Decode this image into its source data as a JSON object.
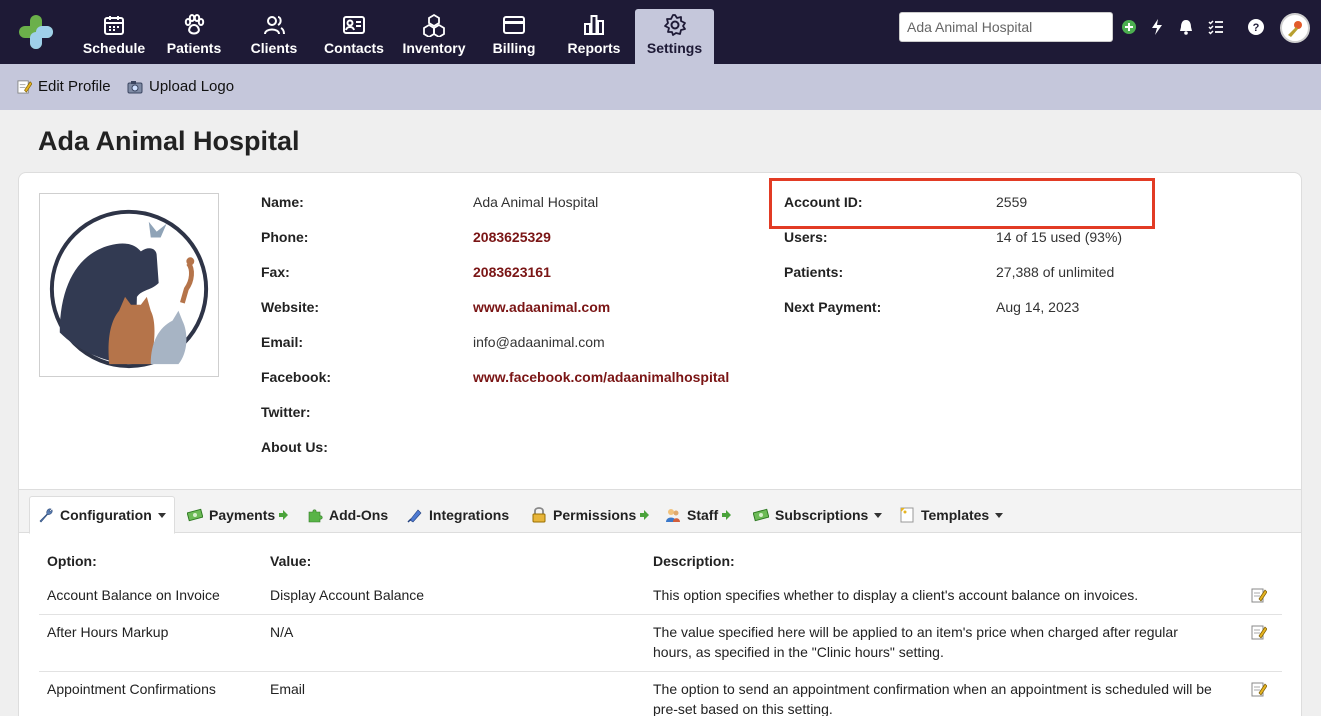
{
  "nav": {
    "items": [
      {
        "label": "Schedule",
        "icon": "calendar-icon"
      },
      {
        "label": "Patients",
        "icon": "paw-icon"
      },
      {
        "label": "Clients",
        "icon": "people-icon"
      },
      {
        "label": "Contacts",
        "icon": "contact-card-icon"
      },
      {
        "label": "Inventory",
        "icon": "boxes-icon"
      },
      {
        "label": "Billing",
        "icon": "credit-card-icon"
      },
      {
        "label": "Reports",
        "icon": "bar-chart-icon"
      },
      {
        "label": "Settings",
        "icon": "gear-icon",
        "active": true
      }
    ],
    "search_value": "Ada Animal Hospital"
  },
  "subbar": {
    "edit_profile": "Edit Profile",
    "upload_logo": "Upload Logo"
  },
  "page_title": "Ada Animal Hospital",
  "profile": {
    "left": [
      {
        "label": "Name:",
        "value": "Ada Animal Hospital",
        "link": false
      },
      {
        "label": "Phone:",
        "value": "2083625329",
        "link": true
      },
      {
        "label": "Fax:",
        "value": "2083623161",
        "link": true
      },
      {
        "label": "Website:",
        "value": "www.adaanimal.com",
        "link": true
      },
      {
        "label": "Email:",
        "value": "info@adaanimal.com",
        "link": false
      },
      {
        "label": "Facebook:",
        "value": "www.facebook.com/adaanimalhospital",
        "link": true
      },
      {
        "label": "Twitter:",
        "value": "",
        "link": false
      },
      {
        "label": "About Us:",
        "value": "",
        "link": false
      }
    ],
    "right": [
      {
        "label": "Account ID:",
        "value": "2559"
      },
      {
        "label": "Users:",
        "value": "14 of 15 used (93%)"
      },
      {
        "label": "Patients:",
        "value": "27,388 of unlimited"
      },
      {
        "label": "Next Payment:",
        "value": "Aug 14, 2023"
      }
    ]
  },
  "tabs": [
    {
      "label": "Configuration",
      "icon": "wrench-icon",
      "suffix": "caret"
    },
    {
      "label": "Payments",
      "icon": "money-icon",
      "suffix": "arrow"
    },
    {
      "label": "Add-Ons",
      "icon": "puzzle-icon",
      "suffix": ""
    },
    {
      "label": "Integrations",
      "icon": "plug-icon",
      "suffix": ""
    },
    {
      "label": "Permissions",
      "icon": "lock-icon",
      "suffix": "arrow"
    },
    {
      "label": "Staff",
      "icon": "staff-icon",
      "suffix": "arrow"
    },
    {
      "label": "Subscriptions",
      "icon": "money-icon",
      "suffix": "caret"
    },
    {
      "label": "Templates",
      "icon": "template-icon",
      "suffix": "caret"
    }
  ],
  "table": {
    "headers": {
      "option": "Option:",
      "value": "Value:",
      "description": "Description:"
    },
    "rows": [
      {
        "option": "Account Balance on Invoice",
        "value": "Display Account Balance",
        "description_lines": [
          "This option specifies whether to display a client's account balance on invoices."
        ]
      },
      {
        "option": "After Hours Markup",
        "value": "N/A",
        "description_lines": [
          "The value specified here will be applied to an item's price when charged after regular",
          "hours, as specified in the \"Clinic hours\" setting."
        ]
      },
      {
        "option": "Appointment Confirmations",
        "value": "Email",
        "description_lines": [
          "The option to send an appointment confirmation when an appointment is scheduled will be",
          "pre-set based on this setting."
        ]
      }
    ]
  },
  "colors": {
    "nav_bg": "#1e1a36",
    "subbar_bg": "#c5c7db",
    "link": "#7a1515",
    "highlight": "#e23b24"
  }
}
